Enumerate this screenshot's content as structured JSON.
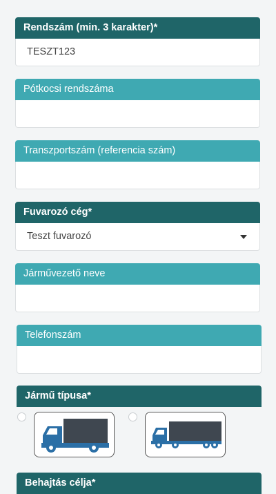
{
  "form": {
    "plate": {
      "label": "Rendszám (min. 3 karakter)*",
      "value": "TESZT123"
    },
    "trailer_plate": {
      "label": "Pótkocsi rendszáma",
      "value": ""
    },
    "transport_number": {
      "label": "Transzportszám (referencia szám)",
      "value": ""
    },
    "carrier": {
      "label": "Fuvarozó cég*",
      "selected": "Teszt fuvarozó"
    },
    "driver_name": {
      "label": "Járművezető neve",
      "value": ""
    },
    "phone": {
      "label": "Telefonszám",
      "value": ""
    },
    "vehicle_type": {
      "label": "Jármű típusa*",
      "options": [
        {
          "icon": "truck-icon"
        },
        {
          "icon": "semi-truck-trailer-icon"
        }
      ]
    },
    "entry_purpose": {
      "label": "Behajtás célja*"
    }
  },
  "colors": {
    "required_header": "#1f6568",
    "optional_header": "#3fa9b2",
    "truck_body": "#2b6fa6",
    "cargo": "#3f4750"
  }
}
